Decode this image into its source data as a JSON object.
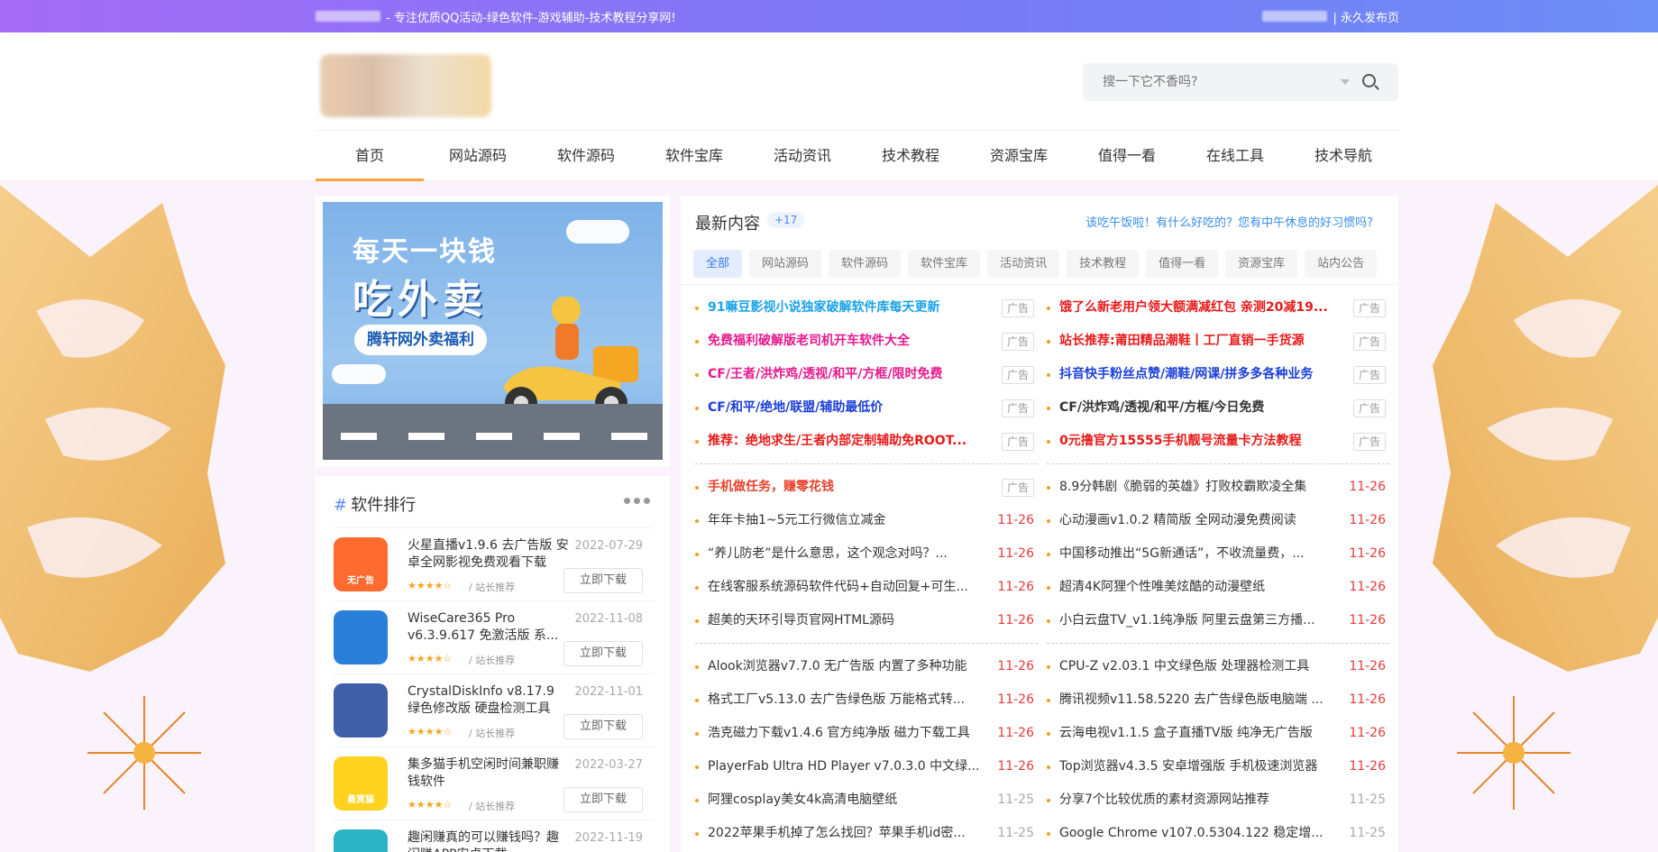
{
  "topbar": {
    "slogan": "- 专注优质QQ活动-绿色软件-游戏辅助-技术教程分享网!",
    "right_link": "| 永久发布页"
  },
  "search": {
    "placeholder": "搜一下它不香吗?"
  },
  "nav": [
    {
      "label": "首页",
      "active": true
    },
    {
      "label": "网站源码"
    },
    {
      "label": "软件源码"
    },
    {
      "label": "软件宝库"
    },
    {
      "label": "活动资讯"
    },
    {
      "label": "技术教程"
    },
    {
      "label": "资源宝库"
    },
    {
      "label": "值得一看"
    },
    {
      "label": "在线工具"
    },
    {
      "label": "技术导航"
    }
  ],
  "banner": {
    "line1": "每天一块钱",
    "line2": "吃外卖",
    "line3": "腾轩网外卖福利"
  },
  "ranking": {
    "title": "软件排行",
    "items": [
      {
        "name": "火星直播v1.9.6 去广告版 安卓全网影视免费观看下载",
        "date": "2022-07-29",
        "stars": "★★★★☆",
        "tag": "/ 站长推荐",
        "button": "立即下载",
        "icon_color": "#ff6a2e",
        "icon": "tv-app-icon",
        "icon_label": "无广告"
      },
      {
        "name": "WiseCare365 Pro v6.3.9.617 免激活版 系...",
        "date": "2022-11-08",
        "stars": "★★★★☆",
        "tag": "/ 站长推荐",
        "button": "立即下载",
        "icon_color": "#2a7fd8",
        "icon": "shield-app-icon"
      },
      {
        "name": "CrystalDiskInfo v8.17.9 绿色修改版 硬盘检测工具",
        "date": "2022-11-01",
        "stars": "★★★★☆",
        "tag": "/ 站长推荐",
        "button": "立即下载",
        "icon_color": "#3f5fa8",
        "icon": "disk-app-icon"
      },
      {
        "name": "集多猫手机空闲时间兼职赚钱软件",
        "date": "2022-03-27",
        "stars": "★★★★☆",
        "tag": "/ 站长推荐",
        "button": "立即下载",
        "icon_color": "#ffd21f",
        "icon": "cat-app-icon",
        "icon_label": "悬赏猫"
      },
      {
        "name": "趣闲赚真的可以赚钱吗？趣闲赚APP安卓下载",
        "date": "2022-11-19",
        "stars": "",
        "tag": "",
        "button": "",
        "icon_color": "#2bb3c6",
        "icon": "earn-app-icon"
      }
    ]
  },
  "content": {
    "title": "最新内容",
    "badge": "+17",
    "link": "该吃午饭啦！有什么好吃的？您有中午休息的好习惯吗?",
    "filters": [
      "全部",
      "网站源码",
      "软件源码",
      "软件宝库",
      "活动资讯",
      "技术教程",
      "值得一看",
      "资源宝库",
      "站内公告"
    ],
    "ads_left": [
      {
        "text": "91嘛豆影视小说独家破解软件库每天更新",
        "color": "#1aa3e8",
        "ad": "广告"
      },
      {
        "text": "免费福利破解版老司机开车软件大全",
        "color": "#e8198b",
        "ad": "广告"
      },
      {
        "text": "CF/王者/洪炸鸡/透视/和平/方框/限时免费",
        "color": "#e8198b",
        "ad": "广告"
      },
      {
        "text": "CF/和平/绝地/联盟/辅助最低价",
        "color": "#1a3fd8",
        "ad": "广告"
      },
      {
        "text": "推荐：绝地求生/王者内部定制辅助免ROOT...",
        "color": "#e81a1a",
        "ad": "广告"
      }
    ],
    "ads_right": [
      {
        "text": "饿了么新老用户领大额满减红包 亲测20减19...",
        "color": "#e81a1a",
        "ad": "广告"
      },
      {
        "text": "站长推荐:莆田精品潮鞋丨工厂直销一手货源",
        "color": "#e81a1a",
        "ad": "广告"
      },
      {
        "text": "抖音快手粉丝点赞/潮鞋/网课/拼多多各种业务",
        "color": "#1a3fd8",
        "ad": "广告"
      },
      {
        "text": "CF/洪炸鸡/透视/和平/方框/今日免费",
        "color": "#333333",
        "ad": "广告"
      },
      {
        "text": "0元撸官方15555手机靓号流量卡方法教程",
        "color": "#e81a1a",
        "ad": "广告"
      }
    ],
    "left_group1": [
      {
        "text": "手机做任务，赚零花钱",
        "color": "#e8402a",
        "ad": "广告"
      },
      {
        "text": "年年卡抽1~5元工行微信立减金",
        "date": "11-26"
      },
      {
        "text": "“养儿防老”是什么意思，这个观念对吗？...",
        "date": "11-26"
      },
      {
        "text": "在线客服系统源码软件代码+自动回复+可生...",
        "date": "11-26"
      },
      {
        "text": "超美的天环引导页官网HTML源码",
        "date": "11-26"
      }
    ],
    "right_group1": [
      {
        "text": "8.9分韩剧《脆弱的英雄》打败校霸欺凌全集",
        "date": "11-26"
      },
      {
        "text": "心动漫画v1.0.2 精简版 全网动漫免费阅读",
        "date": "11-26"
      },
      {
        "text": "中国移动推出“5G新通话”，不收流量费，...",
        "date": "11-26"
      },
      {
        "text": "超清4K阿狸个性唯美炫酷的动漫壁纸",
        "date": "11-26"
      },
      {
        "text": "小白云盘TV_v1.1纯净版 阿里云盘第三方播...",
        "date": "11-26"
      }
    ],
    "left_group2": [
      {
        "text": "Alook浏览器v7.7.0 无广告版 内置了多种功能",
        "date": "11-26"
      },
      {
        "text": "格式工厂v5.13.0 去广告绿色版 万能格式转...",
        "date": "11-26"
      },
      {
        "text": "浩克磁力下载v1.4.6 官方纯净版 磁力下载工具",
        "date": "11-26"
      },
      {
        "text": "PlayerFab Ultra HD Player v7.0.3.0 中文绿...",
        "date": "11-26"
      },
      {
        "text": "阿狸cosplay美女4k高清电脑壁纸",
        "date": "11-25",
        "old": true
      },
      {
        "text": "2022苹果手机掉了怎么找回？苹果手机id密...",
        "date": "11-25",
        "old": true
      }
    ],
    "right_group2": [
      {
        "text": "CPU-Z v2.03.1 中文绿色版 处理器检测工具",
        "date": "11-26"
      },
      {
        "text": "腾讯视频v11.58.5220 去广告绿色版电脑端 ...",
        "date": "11-26"
      },
      {
        "text": "云海电视v1.1.5 盒子直播TV版 纯净无广告版",
        "date": "11-26"
      },
      {
        "text": "Top浏览器v4.3.5 安卓增强版 手机极速浏览器",
        "date": "11-26"
      },
      {
        "text": "分享7个比较优质的素材资源网站推荐",
        "date": "11-25",
        "old": true
      },
      {
        "text": "Google Chrome v107.0.5304.122 稳定增...",
        "date": "11-25",
        "old": true
      }
    ]
  }
}
